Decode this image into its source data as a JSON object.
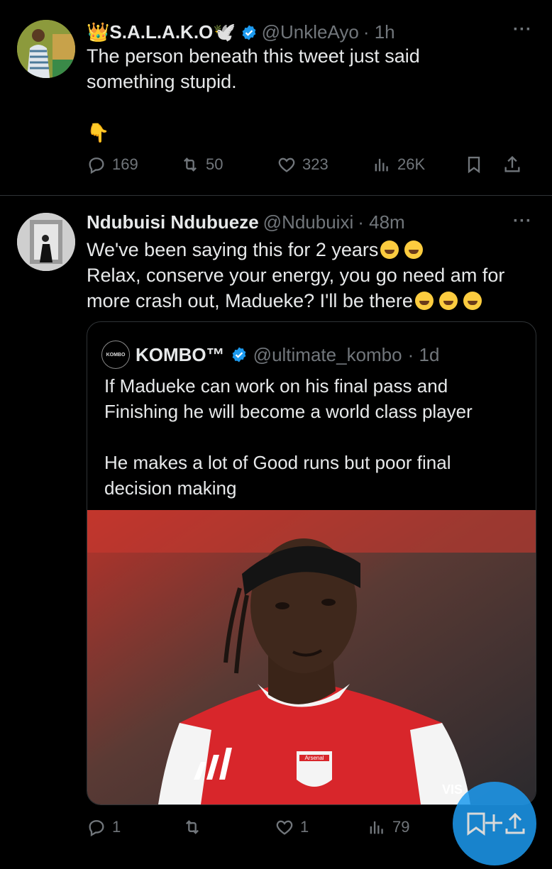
{
  "tweet1": {
    "name": "👑S.A.L.A.K.O🕊️",
    "handle": "@UnkleAyo",
    "time": "· 1h",
    "more": "···",
    "text_line1": "The person beneath this tweet just said",
    "text_line2": "something stupid.",
    "pointer": "👇",
    "stats": {
      "replies": "169",
      "reposts": "50",
      "likes": "323",
      "views": "26K"
    }
  },
  "tweet2": {
    "name": "Ndubuisi Ndubueze",
    "handle": "@Ndubuixi",
    "time": "· 48m",
    "more": "···",
    "text_line1": "We've been saying this for 2 years",
    "text_line2": "Relax, conserve your energy, you go need am for",
    "text_line3": "more crash out, Madueke? I'll be there",
    "stats": {
      "replies": "1",
      "reposts": "",
      "likes": "1",
      "views": "79"
    }
  },
  "quote": {
    "logo_text": "KOMBO",
    "name": "KOMBO™",
    "handle": "@ultimate_kombo",
    "time": "· 1d",
    "text_line1": "If Madueke can work on his final pass and",
    "text_line2": "Finishing he will become a world class player",
    "text_line3": "He makes a lot of Good runs but poor final",
    "text_line4": "decision making",
    "image": {
      "badge_text": "Arsenal",
      "sponsor_text": "VIS"
    }
  },
  "colors": {
    "accent": "#1d9bf0",
    "muted": "#71767b",
    "text": "#e7e9ea",
    "divider": "#2f3336"
  },
  "icons": [
    "reply-icon",
    "repost-icon",
    "like-icon",
    "views-icon",
    "bookmark-icon",
    "share-icon",
    "verified-icon",
    "compose-icon"
  ]
}
